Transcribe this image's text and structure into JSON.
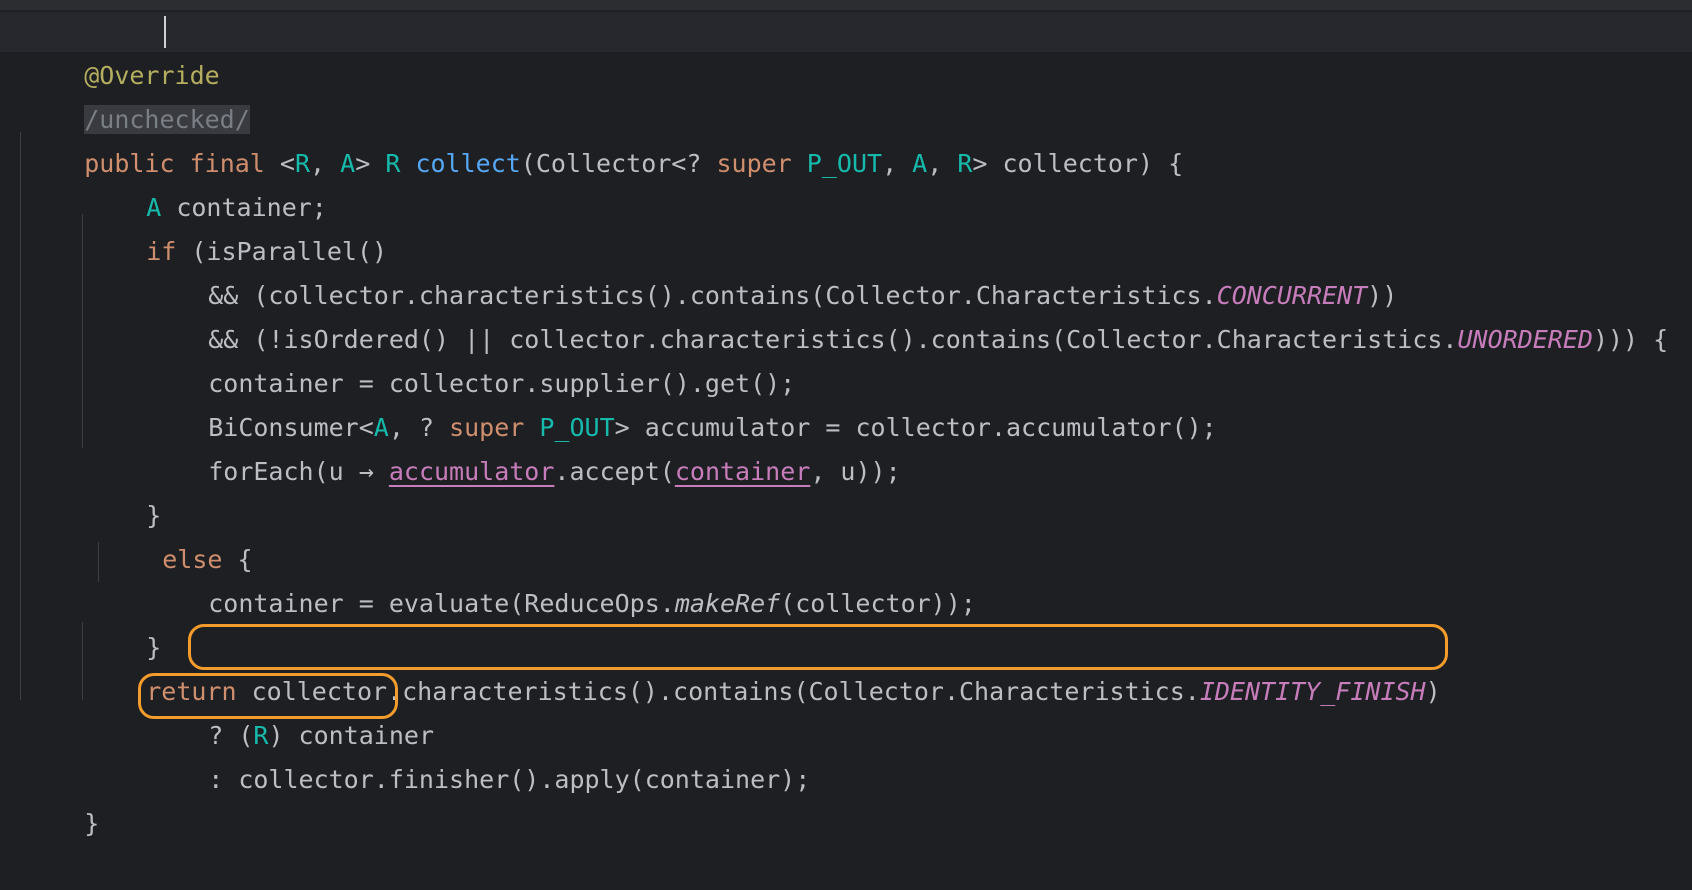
{
  "code": {
    "l1": [
      "@Override"
    ],
    "l2": [
      "/unchecked/"
    ],
    "l3": [
      "public",
      " ",
      "final",
      " <",
      "R",
      ", ",
      "A",
      "> ",
      "R",
      " ",
      "collect",
      "(Collector<? ",
      "super",
      " ",
      "P_OUT",
      ", ",
      "A",
      ", ",
      "R",
      "> collector) {"
    ],
    "l4": [
      "A",
      " container;"
    ],
    "l5": [
      "if",
      " (isParallel()"
    ],
    "l6": [
      "&& (collector.characteristics().contains(Collector.Characteristics.",
      "CONCURRENT",
      "))"
    ],
    "l7": [
      "&& (!isOrdered() || collector.characteristics().contains(Collector.Characteristics.",
      "UNORDERED",
      "))) {"
    ],
    "l8": [
      "container = collector.supplier().get();"
    ],
    "l9": [
      "BiConsumer<",
      "A",
      ", ? ",
      "super",
      " ",
      "P_OUT",
      "> accumulator = collector.accumulator();"
    ],
    "l10": [
      "forEach(u → ",
      "accumulator",
      ".accept(",
      "container",
      ", u));"
    ],
    "l11": [
      "}"
    ],
    "l12": [
      "else",
      " {"
    ],
    "l13": [
      "container = evaluate(ReduceOps.",
      "makeRef",
      "(collector));"
    ],
    "l14": [
      "}"
    ],
    "l15": [
      "return",
      " ",
      "collector.characteristics().contains(Collector.Characteristics.",
      "IDENTITY_FINISH",
      ")"
    ],
    "l16": [
      "? (",
      "R",
      ") container"
    ],
    "l17": [
      ": collector.finisher().apply(container);"
    ],
    "l18": [
      "}"
    ]
  },
  "colors": {
    "background": "#1e1f22",
    "keyword": "#cf8e6d",
    "type_param": "#16baac",
    "function": "#56a8f5",
    "annotation": "#b3ae60",
    "constant": "#c77dbb",
    "text": "#bcbec4",
    "highlight_box": "#f39c2b"
  }
}
